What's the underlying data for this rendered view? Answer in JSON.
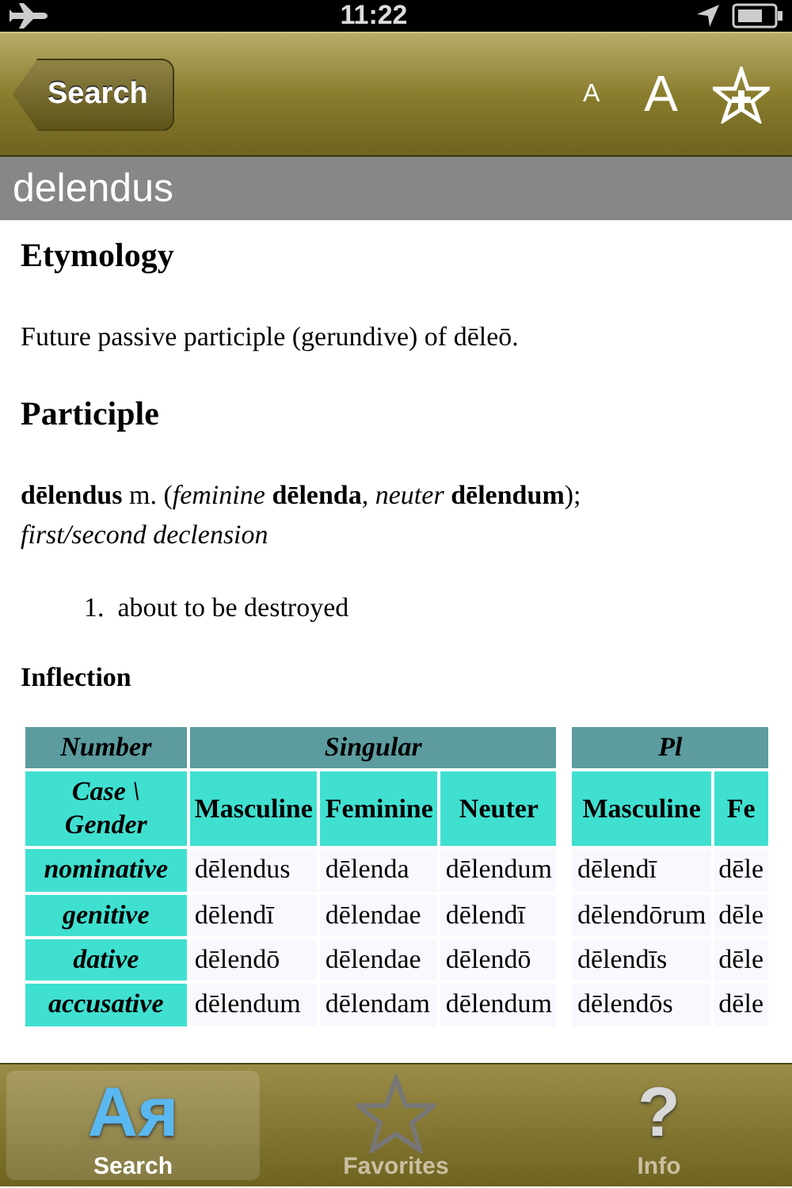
{
  "status_bar": {
    "time": "11:22"
  },
  "nav_bar": {
    "back_button": "Search",
    "font_small": "A",
    "font_large": "A"
  },
  "entry_title": "delendus",
  "blocks": [
    {
      "kind": "heading",
      "text": "Etymology"
    },
    {
      "kind": "paragraph",
      "text": "Future passive participle (gerundive) of dēleō."
    },
    {
      "kind": "heading",
      "text": "Participle"
    },
    {
      "kind": "headword",
      "text": "**dēlendus** m. (*feminine* **dēlenda**, *neuter* **dēlendum**);"
    },
    {
      "kind": "note",
      "text": "first/second declension"
    },
    {
      "kind": "sense",
      "number": "1.",
      "text": "about to be destroyed"
    },
    {
      "kind": "subheading",
      "text": "Inflection"
    }
  ],
  "inflection_table": {
    "number_header": "Number",
    "case_header": "Case \\ Gender",
    "groups": [
      {
        "label": "Singular",
        "genders": [
          "Masculine",
          "Feminine",
          "Neuter"
        ]
      },
      {
        "label": "Pl",
        "genders": [
          "Masculine",
          "Fe"
        ]
      }
    ],
    "rows": [
      {
        "case": "nominative",
        "cells": [
          [
            "dēlendus",
            "dēlenda",
            "dēlendum"
          ],
          [
            "dēlendī",
            "dēle"
          ]
        ]
      },
      {
        "case": "genitive",
        "cells": [
          [
            "dēlendī",
            "dēlendae",
            "dēlendī"
          ],
          [
            "dēlendōrum",
            "dēle"
          ]
        ]
      },
      {
        "case": "dative",
        "cells": [
          [
            "dēlendō",
            "dēlendae",
            "dēlendō"
          ],
          [
            "dēlendīs",
            "dēle"
          ]
        ]
      },
      {
        "case": "accusative",
        "cells": [
          [
            "dēlendum",
            "dēlendam",
            "dēlendum"
          ],
          [
            "dēlendōs",
            "dēle"
          ]
        ]
      }
    ]
  },
  "tab_bar": [
    {
      "label": "Search",
      "kind": "glyph",
      "glyph": "Aя",
      "selected": true
    },
    {
      "label": "Favorites",
      "kind": "star",
      "selected": false
    },
    {
      "label": "Info",
      "kind": "glyph",
      "glyph": "?",
      "selected": false
    }
  ]
}
